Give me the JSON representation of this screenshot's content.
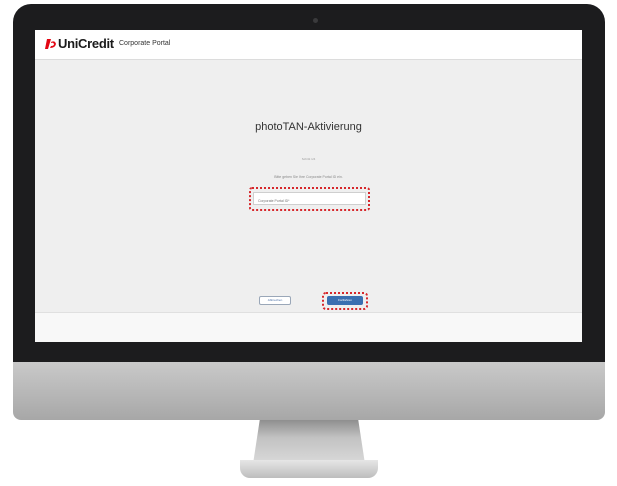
{
  "app": {
    "brand": "UniCredit",
    "portal_name": "Corporate Portal"
  },
  "page": {
    "title": "photoTAN-Aktivierung",
    "step": "Schritt 1/4",
    "instruction": "Bitte geben Sie Ihre Corporate Portal ID ein."
  },
  "form": {
    "id_placeholder": "Corporate Portal ID*"
  },
  "actions": {
    "back_label": "Abbrechen",
    "next_label": "Fortfahren"
  },
  "colors": {
    "brand_red": "#e30613",
    "highlight": "#d6272b",
    "primary_button": "#3a6fb0"
  }
}
